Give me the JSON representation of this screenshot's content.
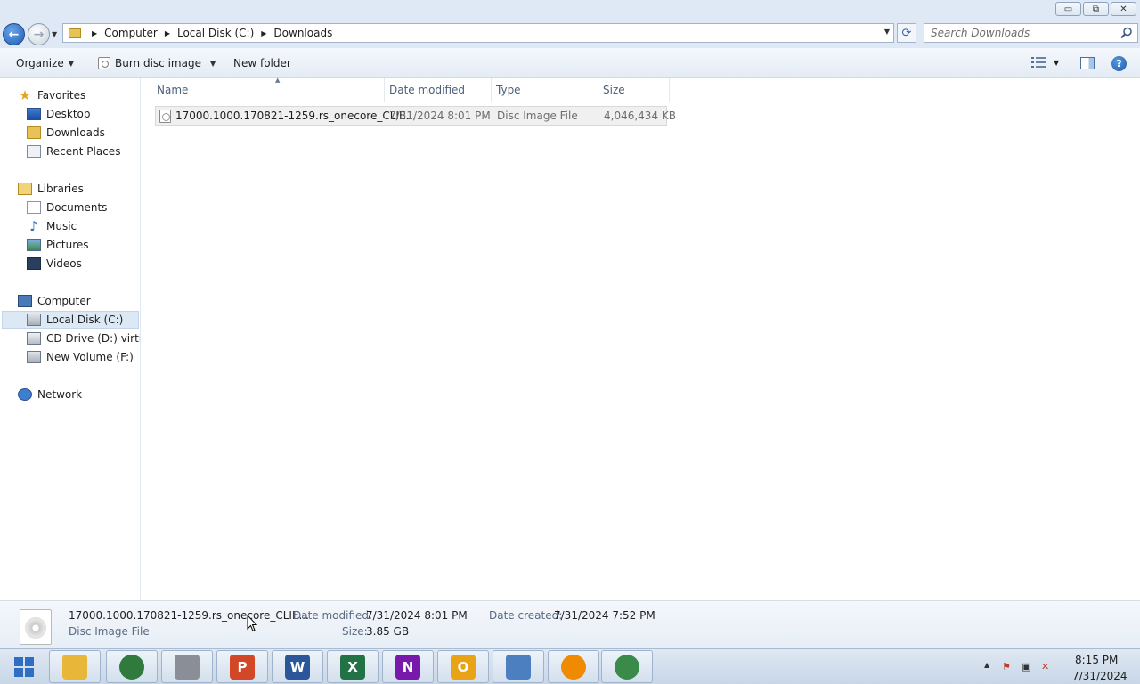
{
  "window": {
    "minimize_glyph": "▭",
    "maximize_glyph": "⧉",
    "close_glyph": "✕"
  },
  "address": {
    "crumbs": [
      "Computer",
      "Local Disk (C:)",
      "Downloads"
    ],
    "search_placeholder": "Search Downloads"
  },
  "toolbar": {
    "organize_label": "Organize",
    "burn_label": "Burn disc image",
    "new_folder_label": "New folder"
  },
  "nav": {
    "favorites_header": "Favorites",
    "favorites": [
      "Desktop",
      "Downloads",
      "Recent Places"
    ],
    "libraries_header": "Libraries",
    "libraries": [
      "Documents",
      "Music",
      "Pictures",
      "Videos"
    ],
    "computer_header": "Computer",
    "drives": [
      "Local Disk (C:)",
      "CD Drive (D:) virtio-win",
      "New Volume (F:)"
    ],
    "network_header": "Network",
    "selected": "Local Disk (C:)"
  },
  "columns": {
    "name": "Name",
    "date_modified": "Date modified",
    "type": "Type",
    "size": "Size"
  },
  "files": [
    {
      "name": "17000.1000.170821-1259.rs_onecore_CLIE...",
      "date_modified": "7/31/2024 8:01 PM",
      "type": "Disc Image File",
      "size": "4,046,434 KB"
    }
  ],
  "details": {
    "name": "17000.1000.170821-1259.rs_onecore_CLIE...",
    "type": "Disc Image File",
    "date_modified_label": "Date modified:",
    "date_modified": "7/31/2024 8:01 PM",
    "date_created_label": "Date created:",
    "date_created": "7/31/2024 7:52 PM",
    "size_label": "Size:",
    "size": "3.85 GB"
  },
  "taskbar": {
    "apps": [
      {
        "icon": "file-explorer-icon",
        "color": "#e8b73a"
      },
      {
        "icon": "browser-icon",
        "color": "#2f7a3c"
      },
      {
        "icon": "package-icon",
        "color": "#8a8f97"
      },
      {
        "icon": "powerpoint-icon",
        "color": "#d24726",
        "glyph": "P"
      },
      {
        "icon": "word-icon",
        "color": "#2b579a",
        "glyph": "W"
      },
      {
        "icon": "excel-icon",
        "color": "#217346",
        "glyph": "X"
      },
      {
        "icon": "onenote-icon",
        "color": "#7719aa",
        "glyph": "N"
      },
      {
        "icon": "outlook-icon",
        "color": "#e8a317",
        "glyph": "O"
      },
      {
        "icon": "control-panel-icon",
        "color": "#4b7fc0"
      },
      {
        "icon": "vlc-icon",
        "color": "#f08a00"
      },
      {
        "icon": "chrome-icon",
        "color": "#3a8a4a"
      }
    ],
    "time": "8:15 PM",
    "date": "7/31/2024"
  }
}
